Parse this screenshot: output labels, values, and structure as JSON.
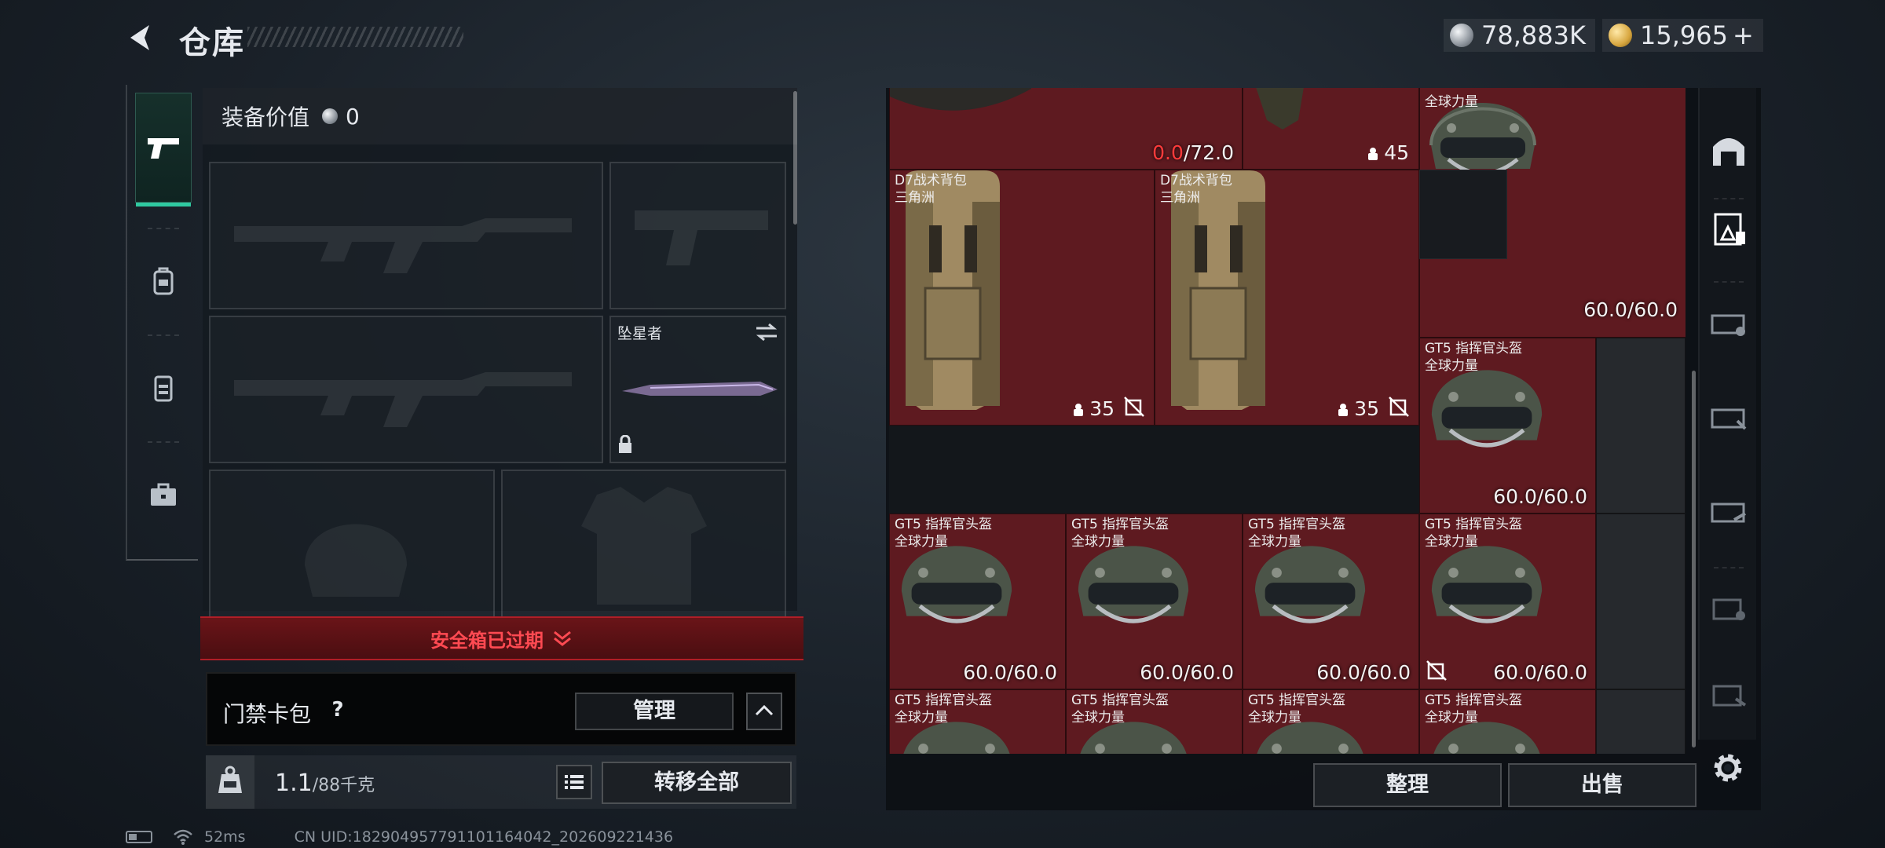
{
  "header": {
    "title": "仓库",
    "currency_silver": "78,883K",
    "currency_gold": "15,965",
    "currency_gold_plus": "+"
  },
  "left_nav": {
    "items": [
      {
        "name": "weapons",
        "icon": "pistol-icon",
        "active": true
      },
      {
        "name": "gear",
        "icon": "backpack-icon",
        "active": false
      },
      {
        "name": "vest",
        "icon": "vest-icon",
        "active": false
      },
      {
        "name": "case",
        "icon": "briefcase-icon",
        "active": false
      }
    ]
  },
  "equipment": {
    "value_label": "装备价值",
    "value": "0",
    "melee_name": "坠星者",
    "safebox_status": "安全箱已过期",
    "card_label": "门禁卡包",
    "help": "?",
    "manage_label": "管理",
    "weight_current": "1.1",
    "weight_max": "/88千克",
    "transfer_all_label": "转移全部"
  },
  "status_bar": {
    "ping": "52ms",
    "uid": "CN UID:18290495779110116404​2_202609221436"
  },
  "stash": {
    "items": [
      {
        "id": "top-gear",
        "name": "",
        "value": "",
        "value_red": "0.0",
        "value_max": "/72.0"
      },
      {
        "id": "top-pack",
        "capacity": "45"
      },
      {
        "id": "helmet-top",
        "name_line1": "",
        "name_line2": "全球力量",
        "value": "60.0/60.0"
      },
      {
        "id": "backpack-1",
        "name_line1": "D7战术背包",
        "name_line2": "三角洲",
        "capacity": "35"
      },
      {
        "id": "backpack-2",
        "name_line1": "D7战术背包",
        "name_line2": "三角洲",
        "capacity": "35"
      },
      {
        "id": "helmet-r1",
        "name_line1": "GT5 指挥官头盔",
        "name_line2": "全球力量",
        "value": "60.0/60.0"
      },
      {
        "id": "helmet-r2a",
        "name_line1": "GT5 指挥官头盔",
        "name_line2": "全球力量",
        "value": "60.0/60.0"
      },
      {
        "id": "helmet-r2b",
        "name_line1": "GT5 指挥官头盔",
        "name_line2": "全球力量",
        "value": "60.0/60.0"
      },
      {
        "id": "helmet-r2c",
        "name_line1": "GT5 指挥官头盔",
        "name_line2": "全球力量",
        "value": "60.0/60.0"
      },
      {
        "id": "helmet-r2d",
        "name_line1": "GT5 指挥官头盔",
        "name_line2": "全球力量",
        "value": "60.0/60.0"
      },
      {
        "id": "helmet-r3a",
        "name_line1": "GT5 指挥官头盔",
        "name_line2": "全球力量"
      },
      {
        "id": "helmet-r3b",
        "name_line1": "GT5 指挥官头盔",
        "name_line2": "全球力量"
      },
      {
        "id": "helmet-r3c",
        "name_line1": "GT5 指挥官头盔",
        "name_line2": "全球力量"
      },
      {
        "id": "helmet-r3d",
        "name_line1": "GT5 指挥官头盔",
        "name_line2": "全球力量"
      }
    ],
    "tidy_label": "整理",
    "sell_label": "出售"
  },
  "right_tabs": [
    {
      "name": "stash-tab",
      "icon": "storage-arch-icon"
    },
    {
      "name": "storage-tab-1",
      "icon": "storage-level-icon"
    },
    {
      "name": "storage-tab-2",
      "icon": "storage-level-icon"
    },
    {
      "name": "storage-tab-3",
      "icon": "storage-level-icon"
    },
    {
      "name": "storage-tab-4",
      "icon": "storage-level-icon"
    },
    {
      "name": "storage-tab-5",
      "icon": "storage-level-icon"
    },
    {
      "name": "storage-tab-6",
      "icon": "storage-level-icon"
    }
  ],
  "colors": {
    "item_bg": "#5e1a20",
    "accent": "#2fc9a0",
    "alert_red": "#ff4a52"
  }
}
